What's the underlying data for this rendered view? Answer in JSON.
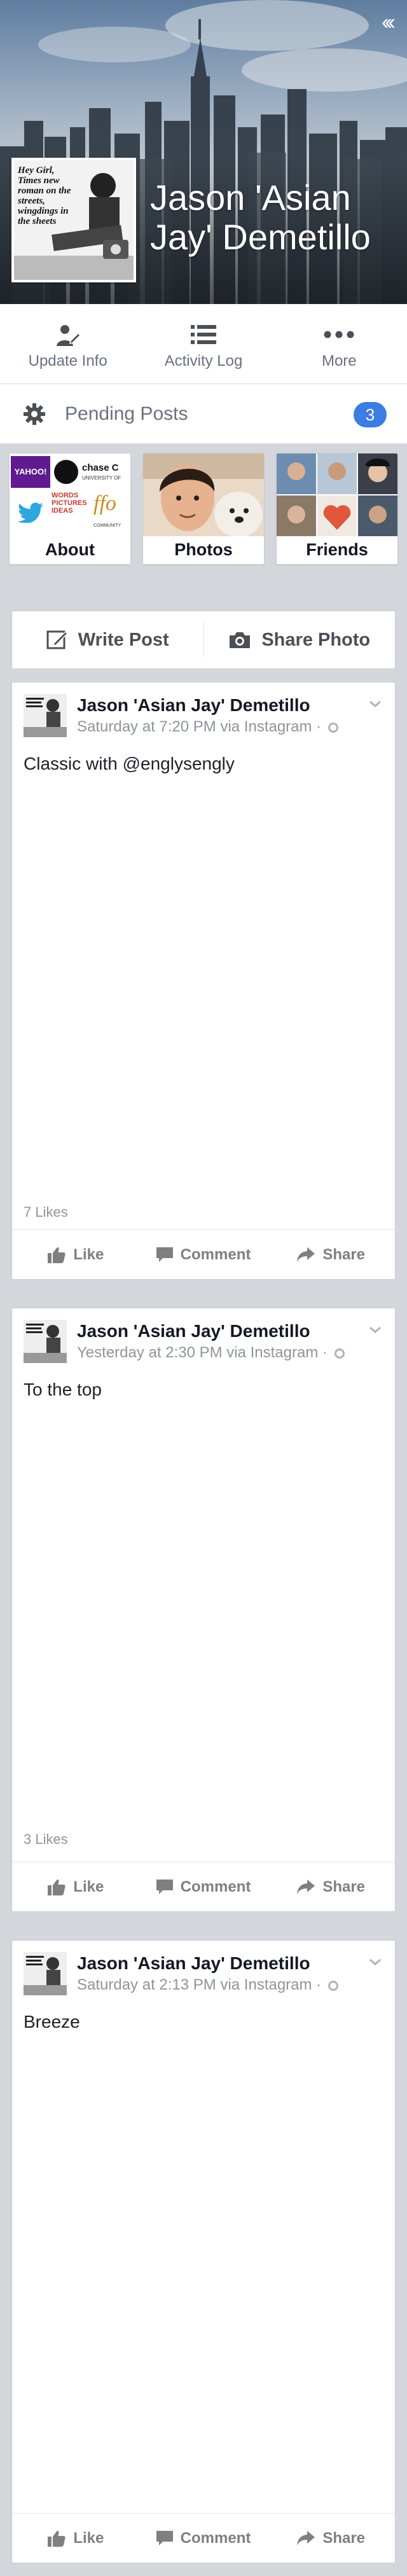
{
  "profile": {
    "name": "Jason 'Asian Jay' Demetillo",
    "profile_pic_text": "Hey Girl, Times new roman on the streets, wingdings in the sheets"
  },
  "actions": [
    {
      "label": "Update Info",
      "icon": "person-pencil-icon"
    },
    {
      "label": "Activity Log",
      "icon": "list-icon"
    },
    {
      "label": "More",
      "icon": "more-dots-icon"
    }
  ],
  "pending": {
    "label": "Pending Posts",
    "count": "3",
    "badge_color": "#3b7de0"
  },
  "tiles": {
    "about": {
      "label": "About",
      "logo_yahoo": "YAHOO!",
      "logo_chase": "chase C",
      "logo_chase_sub": "UNIVERSITY OF",
      "logo_words": "WORDS PICTURES IDEAS",
      "logo_ffo": "ffo",
      "logo_ffo_sub": "COMMUNITY"
    },
    "photos": {
      "label": "Photos"
    },
    "friends": {
      "label": "Friends"
    }
  },
  "composer": {
    "write": "Write Post",
    "share": "Share Photo"
  },
  "posts": [
    {
      "author": "Jason 'Asian Jay' Demetillo",
      "meta": "Saturday at 7:20 PM via Instagram ·",
      "text": "Classic with @englysengly",
      "likes": "7 Likes"
    },
    {
      "author": "Jason 'Asian Jay' Demetillo",
      "meta": "Yesterday at 2:30 PM via Instagram ·",
      "text": "To the top",
      "likes": "3 Likes"
    },
    {
      "author": "Jason 'Asian Jay' Demetillo",
      "meta": "Saturday at 2:13 PM via Instagram ·",
      "text": "Breeze",
      "likes": ""
    }
  ],
  "post_actions": {
    "like": "Like",
    "comment": "Comment",
    "share": "Share"
  },
  "colors": {
    "accent": "#3b7de0",
    "background": "#d3d6db",
    "muted": "#90949c"
  }
}
